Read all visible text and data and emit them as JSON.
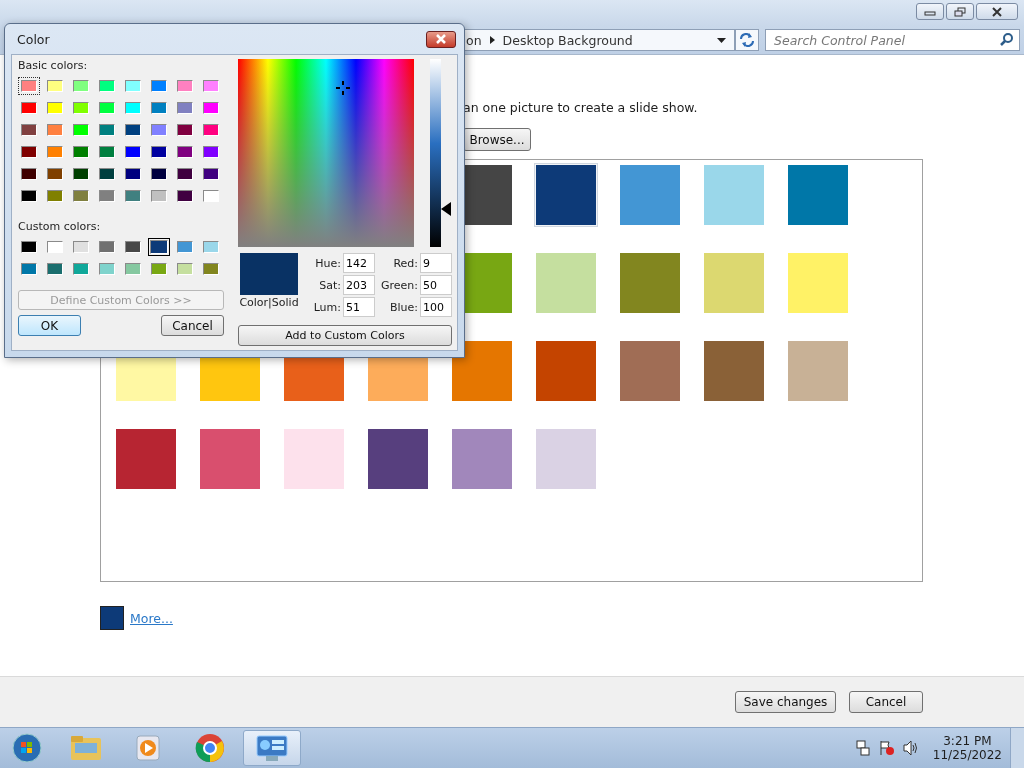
{
  "window": {
    "controls": [
      {
        "kind": "minimize"
      },
      {
        "kind": "maximize"
      },
      {
        "kind": "close"
      }
    ]
  },
  "address_bar": {
    "segments": [
      "on",
      "Desktop Background"
    ]
  },
  "search": {
    "placeholder": "Search Control Panel"
  },
  "intro_text": "an one picture to create a slide show.",
  "browse_button": "Browse...",
  "swatch_rows": [
    {
      "covered": true,
      "swatches": [
        {
          "color": "#454545",
          "selected": false
        },
        {
          "color": "#0d3a78",
          "selected": true
        },
        {
          "color": "#4396d4",
          "selected": false
        },
        {
          "color": "#9ad7ea",
          "selected": false
        },
        {
          "color": "#0077a8",
          "selected": false
        }
      ]
    },
    {
      "covered": true,
      "swatches": [
        {
          "color": "#78a713",
          "selected": false
        },
        {
          "color": "#c5df9f",
          "selected": false
        },
        {
          "color": "#82861f",
          "selected": false
        },
        {
          "color": "#dcd870",
          "selected": false
        },
        {
          "color": "#fff266",
          "selected": false
        }
      ]
    },
    {
      "covered": false,
      "swatches": [
        {
          "color": "#fff8a3",
          "selected": false
        },
        {
          "color": "#ffc60f",
          "selected": false
        },
        {
          "color": "#e8601a",
          "selected": false
        },
        {
          "color": "#fdac5a",
          "selected": false
        },
        {
          "color": "#e57600",
          "selected": false
        },
        {
          "color": "#c44400",
          "selected": false
        },
        {
          "color": "#a06d55",
          "selected": false
        },
        {
          "color": "#8a6137",
          "selected": false
        },
        {
          "color": "#c8b196",
          "selected": false
        }
      ]
    },
    {
      "covered": false,
      "swatches": [
        {
          "color": "#b72532",
          "selected": false
        },
        {
          "color": "#d94f6e",
          "selected": false
        },
        {
          "color": "#fde1ec",
          "selected": false
        },
        {
          "color": "#573f7e",
          "selected": false
        },
        {
          "color": "#a187bb",
          "selected": false
        },
        {
          "color": "#dad2e4",
          "selected": false
        }
      ]
    }
  ],
  "current_color": {
    "color": "#0d3a78",
    "link": "More..."
  },
  "footer_buttons": [
    "Save changes",
    "Cancel"
  ],
  "dialog": {
    "title": "Color",
    "basic_label": "Basic colors:",
    "basic_colors": [
      {
        "color": "#ff8080",
        "selected": true
      },
      {
        "color": "#ffff80",
        "selected": false
      },
      {
        "color": "#80ff80",
        "selected": false
      },
      {
        "color": "#00ff80",
        "selected": false
      },
      {
        "color": "#80ffff",
        "selected": false
      },
      {
        "color": "#0080ff",
        "selected": false
      },
      {
        "color": "#ff80c0",
        "selected": false
      },
      {
        "color": "#ff80ff",
        "selected": false
      },
      {
        "color": "#ff0000",
        "selected": false
      },
      {
        "color": "#ffff00",
        "selected": false
      },
      {
        "color": "#80ff00",
        "selected": false
      },
      {
        "color": "#00ff40",
        "selected": false
      },
      {
        "color": "#00ffff",
        "selected": false
      },
      {
        "color": "#0080c0",
        "selected": false
      },
      {
        "color": "#8080c0",
        "selected": false
      },
      {
        "color": "#ff00ff",
        "selected": false
      },
      {
        "color": "#804040",
        "selected": false
      },
      {
        "color": "#ff8040",
        "selected": false
      },
      {
        "color": "#00ff00",
        "selected": false
      },
      {
        "color": "#008080",
        "selected": false
      },
      {
        "color": "#004080",
        "selected": false
      },
      {
        "color": "#8080ff",
        "selected": false
      },
      {
        "color": "#800040",
        "selected": false
      },
      {
        "color": "#ff0080",
        "selected": false
      },
      {
        "color": "#800000",
        "selected": false
      },
      {
        "color": "#ff8000",
        "selected": false
      },
      {
        "color": "#008000",
        "selected": false
      },
      {
        "color": "#008040",
        "selected": false
      },
      {
        "color": "#0000ff",
        "selected": false
      },
      {
        "color": "#0000a0",
        "selected": false
      },
      {
        "color": "#800080",
        "selected": false
      },
      {
        "color": "#8000ff",
        "selected": false
      },
      {
        "color": "#400000",
        "selected": false
      },
      {
        "color": "#804000",
        "selected": false
      },
      {
        "color": "#004000",
        "selected": false
      },
      {
        "color": "#004040",
        "selected": false
      },
      {
        "color": "#000080",
        "selected": false
      },
      {
        "color": "#000040",
        "selected": false
      },
      {
        "color": "#400040",
        "selected": false
      },
      {
        "color": "#400080",
        "selected": false
      },
      {
        "color": "#000000",
        "selected": false
      },
      {
        "color": "#808000",
        "selected": false
      },
      {
        "color": "#808040",
        "selected": false
      },
      {
        "color": "#808080",
        "selected": false
      },
      {
        "color": "#408080",
        "selected": false
      },
      {
        "color": "#c0c0c0",
        "selected": false
      },
      {
        "color": "#400041",
        "selected": false
      },
      {
        "color": "#ffffff",
        "selected": false
      }
    ],
    "custom_label": "Custom colors:",
    "custom_colors": [
      {
        "color": "#000000",
        "selected": false
      },
      {
        "color": "#ffffff",
        "selected": false
      },
      {
        "color": "#e0e0e0",
        "selected": false
      },
      {
        "color": "#707070",
        "selected": false
      },
      {
        "color": "#474747",
        "selected": false
      },
      {
        "color": "#0d3a78",
        "selected": true
      },
      {
        "color": "#4396d4",
        "selected": false
      },
      {
        "color": "#9ad7ea",
        "selected": false
      },
      {
        "color": "#0077a8",
        "selected": false
      },
      {
        "color": "#1a6e6e",
        "selected": false
      },
      {
        "color": "#10a89a",
        "selected": false
      },
      {
        "color": "#7fd3cc",
        "selected": false
      },
      {
        "color": "#85c8a0",
        "selected": false
      },
      {
        "color": "#79a813",
        "selected": false
      },
      {
        "color": "#c5df9f",
        "selected": false
      },
      {
        "color": "#82861f",
        "selected": false
      }
    ],
    "define_button": {
      "label": "Define Custom Colors >>",
      "disabled": true
    },
    "ok_button": "OK",
    "cancel_button": "Cancel",
    "luminance": {
      "level": 0.2
    },
    "preview": {
      "color": "#093264",
      "label": "Color|Solid"
    },
    "fields": [
      {
        "label": "Hue:",
        "value": "142"
      },
      {
        "label": "Red:",
        "value": "9"
      },
      {
        "label": "Sat:",
        "value": "203"
      },
      {
        "label": "Green:",
        "value": "50"
      },
      {
        "label": "Lum:",
        "value": "51"
      },
      {
        "label": "Blue:",
        "value": "100"
      }
    ],
    "add_button": "Add to Custom Colors"
  },
  "taskbar": {
    "apps": [
      {
        "kind": "folder",
        "selected": false
      },
      {
        "kind": "player",
        "selected": false
      },
      {
        "kind": "round",
        "selected": false
      },
      {
        "kind": "panel",
        "selected": true
      }
    ],
    "tray": [
      {
        "kind": "network"
      },
      {
        "kind": "flag"
      },
      {
        "kind": "speaker"
      }
    ],
    "time": "3:21 PM",
    "date": "11/25/2022"
  }
}
